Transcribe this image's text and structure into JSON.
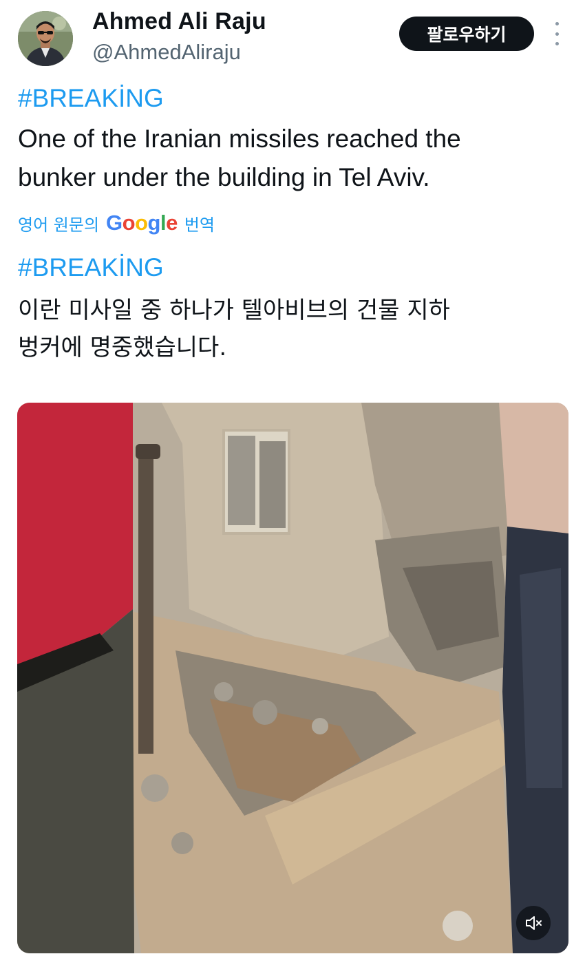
{
  "author": {
    "display_name": "Ahmed Ali Raju",
    "handle": "@AhmedAliraju",
    "avatar_icon": "profile-photo"
  },
  "follow_button": {
    "label": "팔로우하기"
  },
  "more_button": {
    "icon": "more-vertical-icon"
  },
  "tweet": {
    "hashtag": "#BREAKİNG",
    "line1": "One of the Iranian missiles reached the",
    "line2": "bunker under the building in Tel Aviv."
  },
  "translation_bar": {
    "prefix": "영어 원문의",
    "google_letters": [
      "G",
      "o",
      "o",
      "g",
      "l",
      "e"
    ],
    "google_colors": [
      "#4285F4",
      "#EA4335",
      "#FBBC05",
      "#4285F4",
      "#34A853",
      "#EA4335"
    ],
    "suffix": "번역"
  },
  "translated_tweet": {
    "hashtag": "#BREAKİNG",
    "line1": "이란 미사일 중 하나가 텔아비브의 건물 지하",
    "line2": "벙커에 명중했습니다."
  },
  "media": {
    "type": "video",
    "mute_icon": "speaker-muted-icon"
  },
  "colors": {
    "link": "#1d9bf0",
    "text": "#0f1419",
    "secondary": "#536471",
    "button_bg": "#0f1419"
  }
}
